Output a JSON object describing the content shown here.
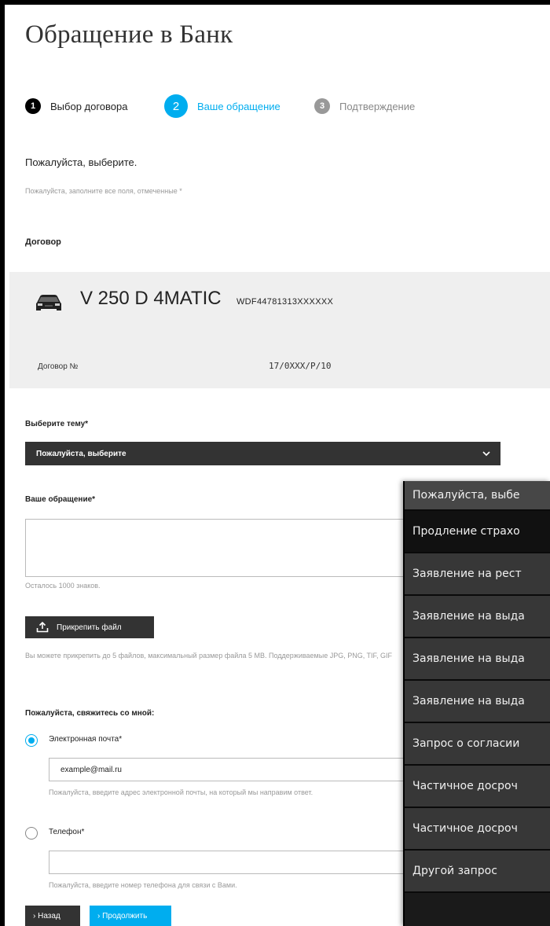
{
  "page": {
    "title": "Обращение в Банк"
  },
  "stepper": {
    "steps": [
      {
        "number": "1",
        "label": "Выбор договора"
      },
      {
        "number": "2",
        "label": "Ваше обращение"
      },
      {
        "number": "3",
        "label": "Подтверждение"
      }
    ],
    "active_index": 1
  },
  "form": {
    "intro": "Пожалуйста, выберите.",
    "required_note": "Пожалуйста, заполните все поля, отмеченные *",
    "contract_heading": "Договор"
  },
  "contract": {
    "model": "V 250 D 4MATIC",
    "vin": "WDF44781313XXXXXX",
    "number_label": "Договор №",
    "number_value": "17/0XXX/P/10"
  },
  "topic": {
    "label": "Выберите тему*",
    "selected": "Пожалуйста, выберите"
  },
  "message": {
    "label": "Ваше обращение*",
    "chars_left": "Осталось 1000 знаков."
  },
  "attach": {
    "button_label": "Прикрепить файл",
    "note": "Вы можете прикрепить до 5 файлов, максимальный размер файла 5 MB. Поддерживаемые JPG, PNG, TIF, GIF"
  },
  "contact": {
    "heading": "Пожалуйста, свяжитесь со мной:",
    "email_label": "Электронная почта*",
    "email_value": "example@mail.ru",
    "email_hint": "Пожалуйста, введите адрес электронной почты, на который мы направим ответ.",
    "phone_label": "Телефон*",
    "phone_hint": "Пожалуйста, введите номер телефона для связи с Вами."
  },
  "buttons": {
    "back": "› Назад",
    "next": "› Продолжить"
  },
  "dropdown": {
    "options": [
      "Пожалуйста, выбе",
      "Продление страхо",
      "Заявление на рест",
      "Заявление на выда",
      "Заявление на выда",
      "Заявление на выда",
      "Запрос о согласии",
      "Частичное досроч",
      "Частичное досроч",
      "Другой запрос"
    ],
    "selected_index": 0,
    "hover_index": 1
  },
  "colors": {
    "accent": "#00adef",
    "dark": "#333333",
    "card_bg": "#efefef"
  }
}
